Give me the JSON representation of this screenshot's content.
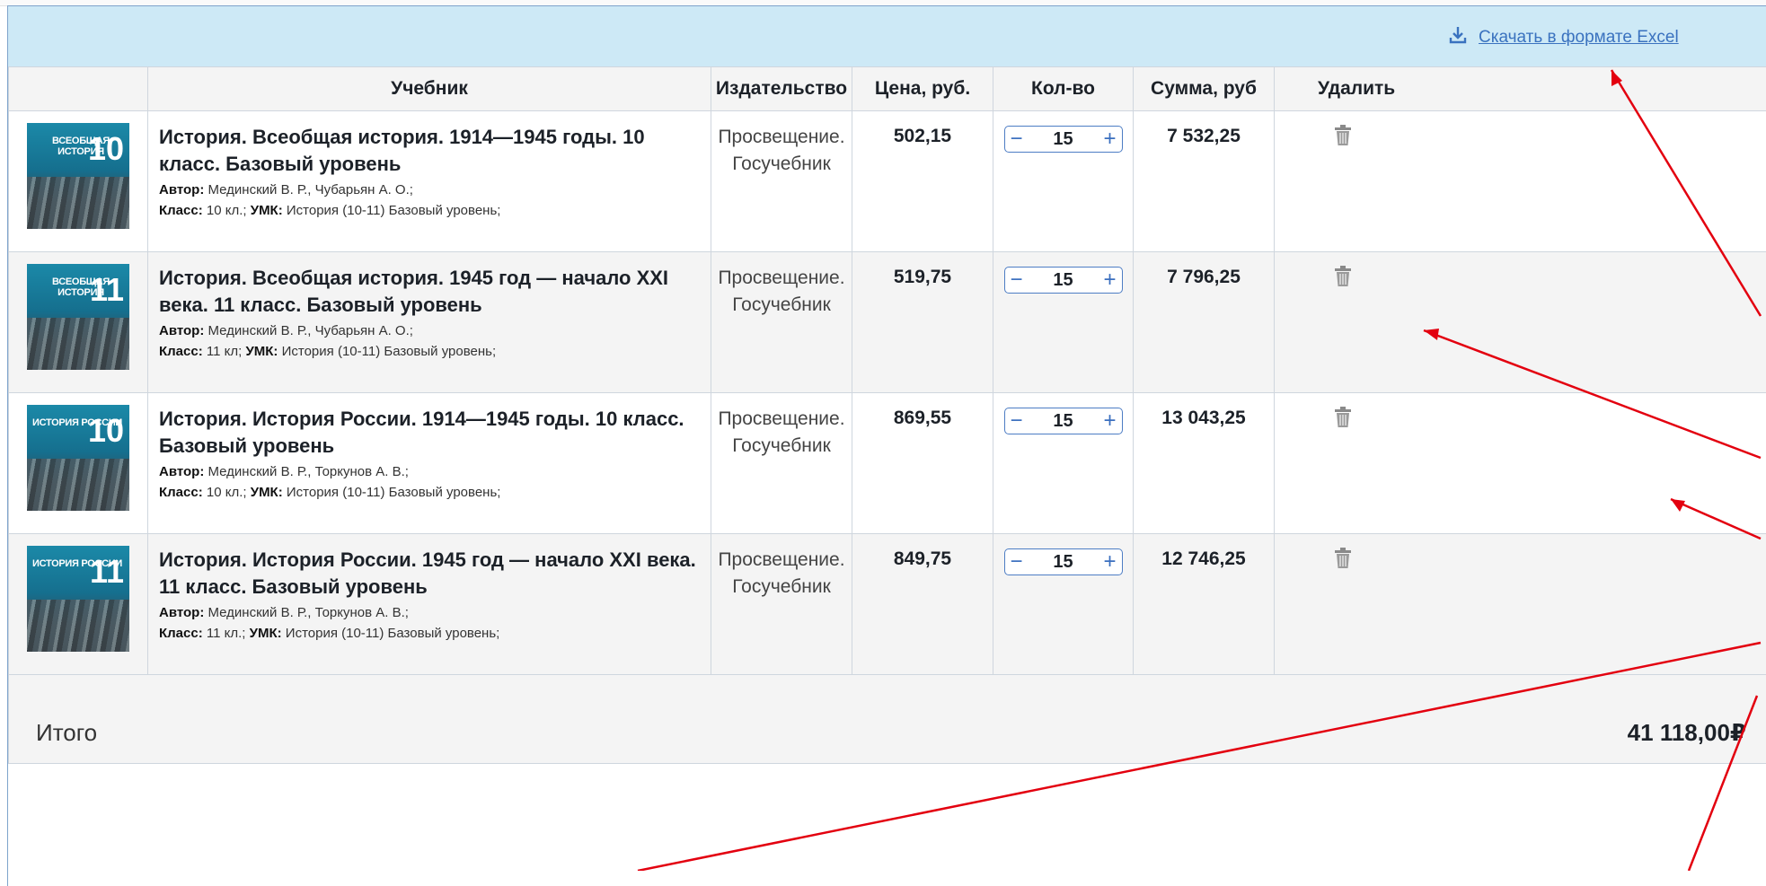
{
  "toolbar": {
    "excel_label": "Скачать в формате Excel"
  },
  "table": {
    "headers": {
      "book": "Учебник",
      "publisher": "Издательство",
      "price": "Цена, руб.",
      "qty": "Кол-во",
      "sum": "Сумма, руб",
      "delete": "Удалить"
    },
    "meta_labels": {
      "author": "Автор:",
      "grade": "Класс:",
      "umk": "УМК:"
    },
    "rows": [
      {
        "cover_title": "Всеобщая история",
        "cover_num": "10",
        "title": "История. Всеобщая история. 1914—1945 годы. 10 класс. Базовый уровень",
        "author": "Мединский В. Р., Чубарьян А. О.;",
        "grade": "10 кл.;",
        "umk": "История (10-11) Базовый уровень;",
        "publisher": "Просвещение. Госучебник",
        "price": "502,15",
        "qty": "15",
        "sum": "7 532,25"
      },
      {
        "cover_title": "Всеобщая история",
        "cover_num": "11",
        "title": "История. Всеобщая история. 1945 год — начало XXI века. 11 класс. Базовый уровень",
        "author": "Мединский В. Р., Чубарьян А. О.;",
        "grade": "11 кл;",
        "umk": "История (10-11) Базовый уровень;",
        "publisher": "Просвещение. Госучебник",
        "price": "519,75",
        "qty": "15",
        "sum": "7 796,25"
      },
      {
        "cover_title": "История России",
        "cover_num": "10",
        "title": "История. История России. 1914—1945 годы. 10 класс. Базовый уровень",
        "author": "Мединский В. Р., Торкунов А. В.;",
        "grade": "10 кл.;",
        "umk": "История (10-11) Базовый уровень;",
        "publisher": "Просвещение. Госучебник",
        "price": "869,55",
        "qty": "15",
        "sum": "13 043,25"
      },
      {
        "cover_title": "История России",
        "cover_num": "11",
        "title": "История. История России. 1945 год — начало XXI века. 11 класс. Базовый уровень",
        "author": "Мединский В. Р., Торкунов А. В.;",
        "grade": "11 кл.;",
        "umk": "История (10-11) Базовый уровень;",
        "publisher": "Просвещение. Госучебник",
        "price": "849,75",
        "qty": "15",
        "sum": "12 746,25"
      }
    ]
  },
  "total": {
    "label": "Итого",
    "value": "41 118,00₽"
  },
  "stepper": {
    "minus": "−",
    "plus": "+"
  },
  "colors": {
    "accent": "#3a72bf",
    "header_bar": "#cde9f6",
    "annotation": "#e3000f"
  }
}
